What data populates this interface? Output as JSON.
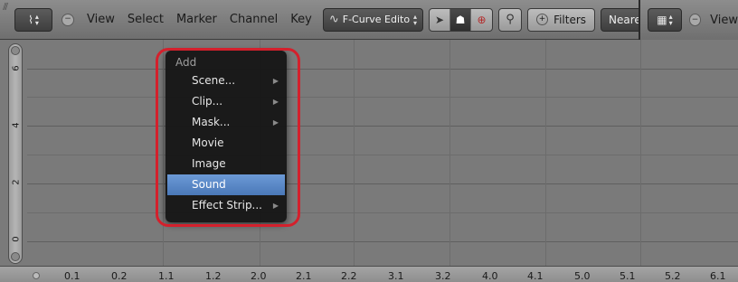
{
  "header": {
    "editor_icon": "graph-editor-icon",
    "menus": [
      "View",
      "Select",
      "Marker",
      "Channel",
      "Key"
    ],
    "mode": {
      "icon": "f-curve-icon",
      "label": "F-Curve Edito"
    },
    "tools": [
      {
        "icon": "cursor-arrow-icon",
        "active": false
      },
      {
        "icon": "ghost-icon",
        "active": true
      },
      {
        "icon": "pivot-target-icon",
        "active": false
      }
    ],
    "magnifier_icon": "magnifier-icon",
    "filters_label": "Filters",
    "snap_label": "Neare"
  },
  "header2": {
    "editor_icon": "properties-editor-icon",
    "menu": "View"
  },
  "grid": {
    "y_labels": [
      "6",
      "4",
      "2",
      "0"
    ]
  },
  "ruler": {
    "x_labels": [
      "0.1",
      "0.2",
      "1.1",
      "1.2",
      "2.0",
      "2.1",
      "2.2",
      "3.1",
      "3.2",
      "4.0",
      "4.1",
      "5.0",
      "5.1",
      "5.2",
      "6.1"
    ]
  },
  "popup": {
    "title": "Add",
    "items": [
      {
        "label": "Scene...",
        "submenu": true,
        "selected": false
      },
      {
        "label": "Clip...",
        "submenu": true,
        "selected": false
      },
      {
        "label": "Mask...",
        "submenu": true,
        "selected": false
      },
      {
        "label": "Movie",
        "submenu": false,
        "selected": false
      },
      {
        "label": "Image",
        "submenu": false,
        "selected": false
      },
      {
        "label": "Sound",
        "submenu": false,
        "selected": true
      },
      {
        "label": "Effect Strip...",
        "submenu": true,
        "selected": false
      }
    ],
    "highlight_color": "#d4202c",
    "selected_color": "#5a88c8"
  }
}
